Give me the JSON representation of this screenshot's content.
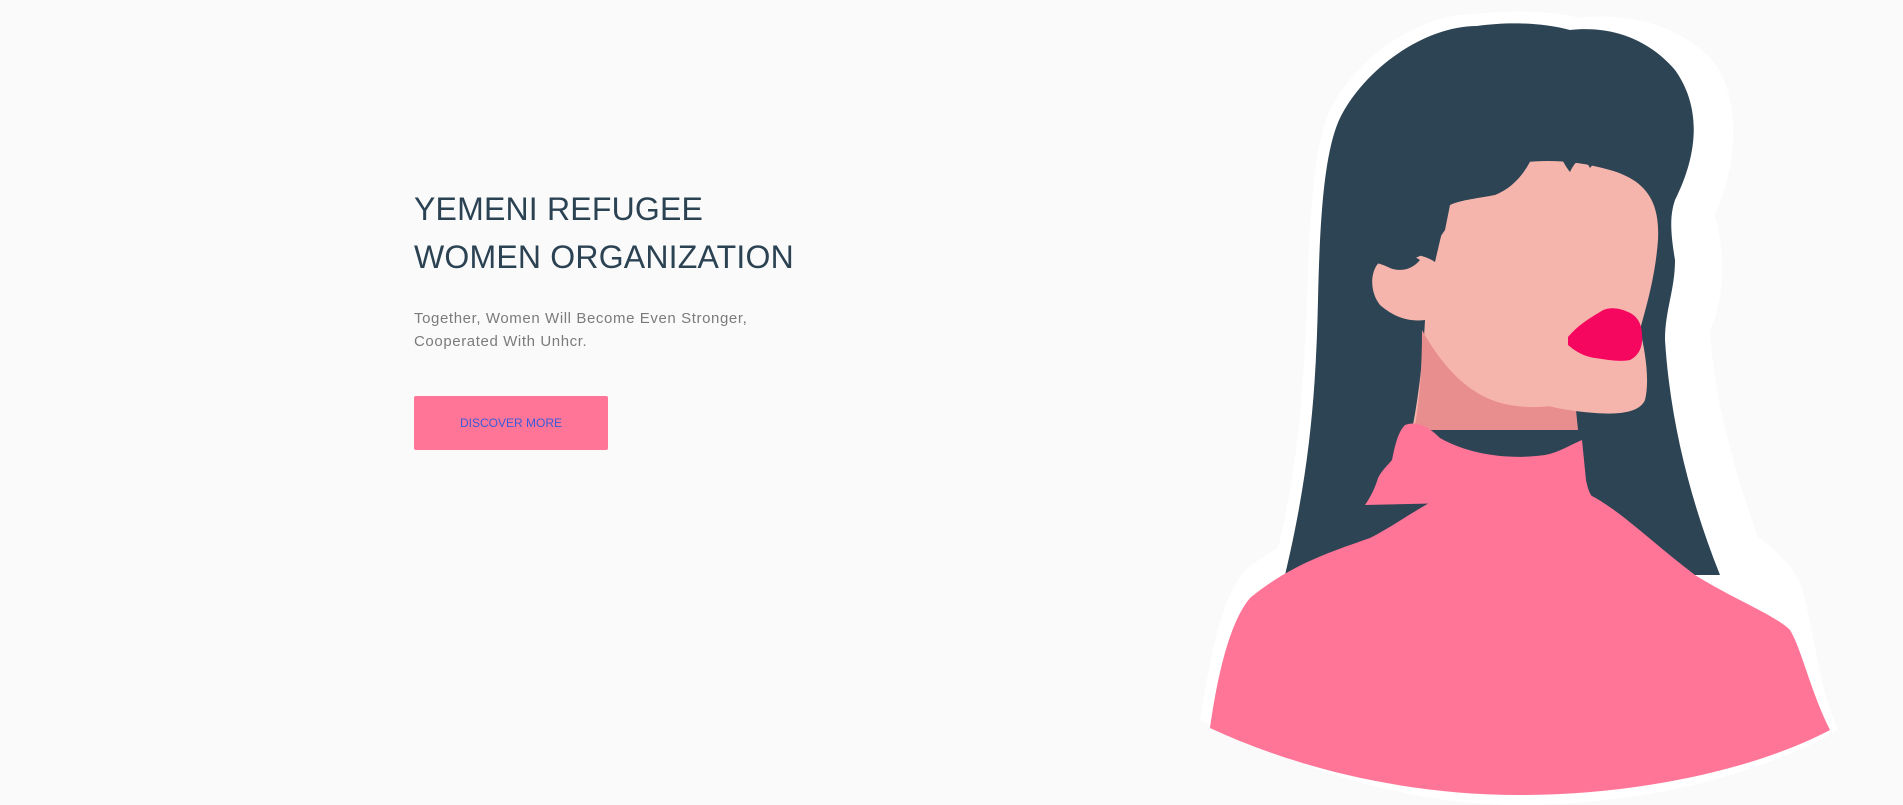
{
  "hero": {
    "title_line_1": "YEMENI REFUGEE",
    "title_line_2": "WOMEN ORGANIZATION",
    "subtitle_line_1": "Together, Women Will Become Even Stronger,",
    "subtitle_line_2": "Cooperated With Unhcr.",
    "cta_label": "DISCOVER MORE"
  },
  "colors": {
    "background": "#fafafa",
    "title": "#2b4253",
    "subtitle": "#7b7b7b",
    "accent": "#ff7597",
    "button_text": "#3a5bd9",
    "hair": "#2c4454",
    "skin": "#f6b5ac",
    "neck_shadow": "#e98e8f",
    "lips": "#f5065f"
  },
  "illustration": {
    "icon": "woman-portrait-illustration"
  }
}
